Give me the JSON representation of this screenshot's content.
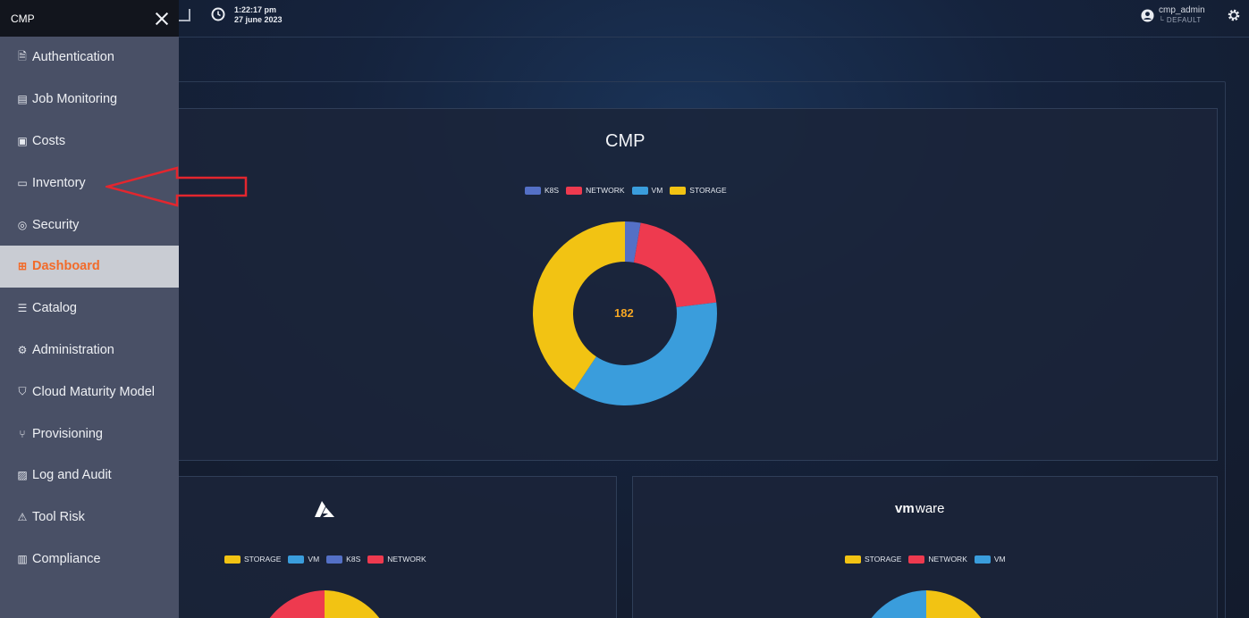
{
  "header": {
    "time": "1:22:17 pm",
    "date": "27 june 2023",
    "user": "cmp_admin",
    "tenant": "DEFAULT"
  },
  "sidebar": {
    "title": "CMP",
    "items": [
      {
        "label": "Authentication",
        "icon": "auth-icon"
      },
      {
        "label": "Job Monitoring",
        "icon": "chart-icon"
      },
      {
        "label": "Costs",
        "icon": "money-icon"
      },
      {
        "label": "Inventory",
        "icon": "folder-icon"
      },
      {
        "label": "Security",
        "icon": "shield-lock-icon"
      },
      {
        "label": "Dashboard",
        "icon": "dashboard-icon",
        "active": true
      },
      {
        "label": "Catalog",
        "icon": "catalog-icon"
      },
      {
        "label": "Administration",
        "icon": "admin-icon"
      },
      {
        "label": "Cloud Maturity Model",
        "icon": "shield-icon"
      },
      {
        "label": "Provisioning",
        "icon": "provisioning-icon"
      },
      {
        "label": "Log and Audit",
        "icon": "log-icon"
      },
      {
        "label": "Tool Risk",
        "icon": "warning-icon"
      },
      {
        "label": "Compliance",
        "icon": "compliance-icon"
      }
    ]
  },
  "colors": {
    "k8s": "#5470c6",
    "network": "#ee3a4f",
    "vm": "#3a9ddc",
    "storage": "#f2c313",
    "accent": "#f26b2a"
  },
  "chart_data": [
    {
      "type": "donut",
      "title": "CMP",
      "center_label": "182",
      "legend": [
        "K8S",
        "NETWORK",
        "VM",
        "STORAGE"
      ],
      "values": [
        5,
        37,
        66,
        74
      ]
    },
    {
      "type": "pie",
      "title": "",
      "legend": [
        "STORAGE",
        "VM",
        "K8S",
        "NETWORK"
      ]
    },
    {
      "type": "pie",
      "title": "",
      "legend": [
        "STORAGE",
        "NETWORK",
        "VM"
      ]
    }
  ]
}
